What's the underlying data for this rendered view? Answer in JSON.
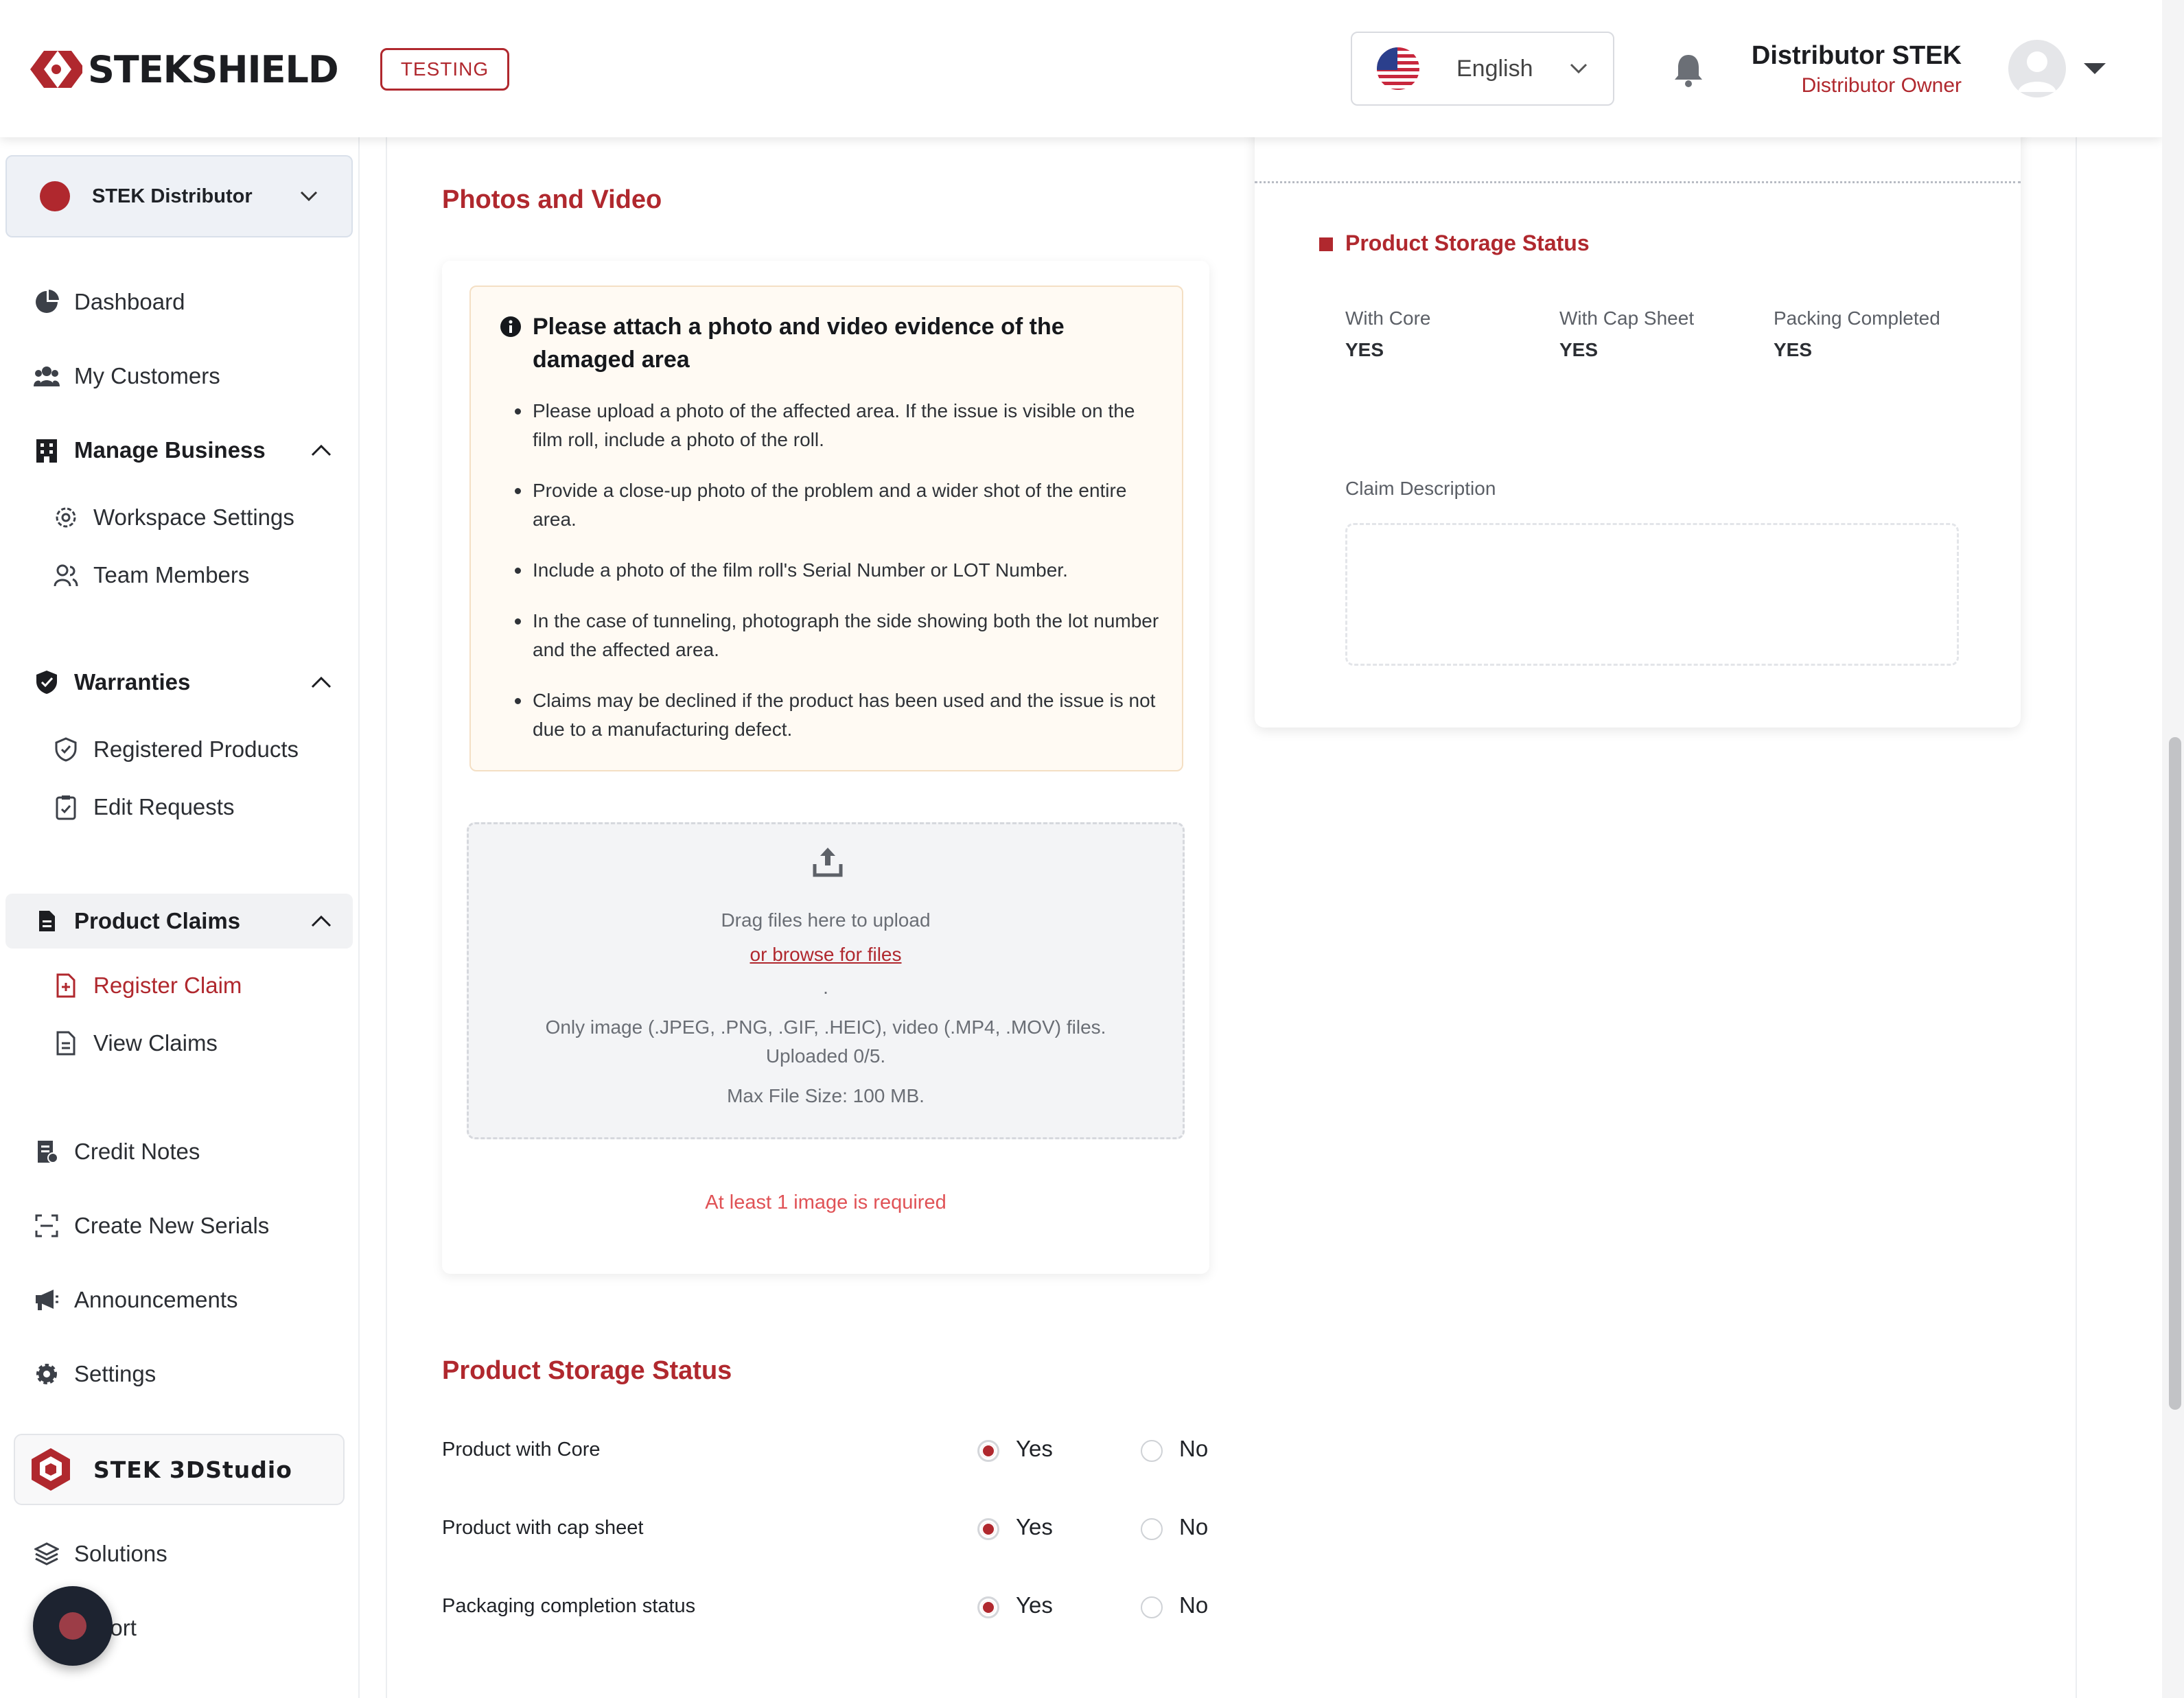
{
  "header": {
    "brand": "STEKSHIELD",
    "env_badge": "TESTING",
    "language": "English",
    "user_name": "Distributor STEK",
    "user_role": "Distributor Owner"
  },
  "sidebar": {
    "org": "STEK Distributor",
    "items": {
      "dashboard": "Dashboard",
      "my_customers": "My Customers",
      "manage_business": "Manage Business",
      "workspace_settings": "Workspace Settings",
      "team_members": "Team Members",
      "warranties": "Warranties",
      "registered_products": "Registered Products",
      "edit_requests": "Edit Requests",
      "product_claims": "Product Claims",
      "register_claim": "Register Claim",
      "view_claims": "View Claims",
      "credit_notes": "Credit Notes",
      "create_new_serials": "Create New Serials",
      "announcements": "Announcements",
      "settings": "Settings",
      "studio": "STEK 3DStudio",
      "solutions": "Solutions",
      "support": "port"
    }
  },
  "photos": {
    "title": "Photos and Video",
    "notice_title": "Please attach a photo and video evidence of the damaged area",
    "notice_items": [
      "Please upload a photo of the affected area. If the issue is visible on the film roll, include a photo of the roll.",
      "Provide a close-up photo of the problem and a wider shot of the entire area.",
      "Include a photo of the film roll's Serial Number or LOT Number.",
      "In the case of tunneling, photograph the side showing both the lot number and the affected area.",
      "Claims may be declined if the product has been used and the issue is not due to a manufacturing defect."
    ],
    "dropzone": {
      "drag_text": "Drag files here to upload",
      "browse_link": "or browse for files",
      "dot": ".",
      "types_text": "Only image (.JPEG, .PNG, .GIF, .HEIC), video (.MP4, .MOV) files.",
      "uploaded_text": "Uploaded 0/5.",
      "max_size_text": "Max File Size: 100 MB."
    },
    "error": "At least 1 image is required"
  },
  "storage": {
    "title": "Product Storage Status",
    "rows": [
      {
        "label": "Product with Core",
        "yes": "Yes",
        "no": "No",
        "selected": "Yes"
      },
      {
        "label": "Product with cap sheet",
        "yes": "Yes",
        "no": "No",
        "selected": "Yes"
      },
      {
        "label": "Packaging completion status",
        "yes": "Yes",
        "no": "No",
        "selected": "Yes"
      }
    ]
  },
  "summary": {
    "title": "Product Storage Status",
    "fields": [
      {
        "label": "With Core",
        "value": "YES"
      },
      {
        "label": "With Cap Sheet",
        "value": "YES"
      },
      {
        "label": "Packing Completed",
        "value": "YES"
      }
    ],
    "claim_description_label": "Claim Description",
    "claim_description": ""
  },
  "colors": {
    "accent": "#b0282e",
    "error": "#e05256",
    "notice_bg": "#fffaf3"
  }
}
